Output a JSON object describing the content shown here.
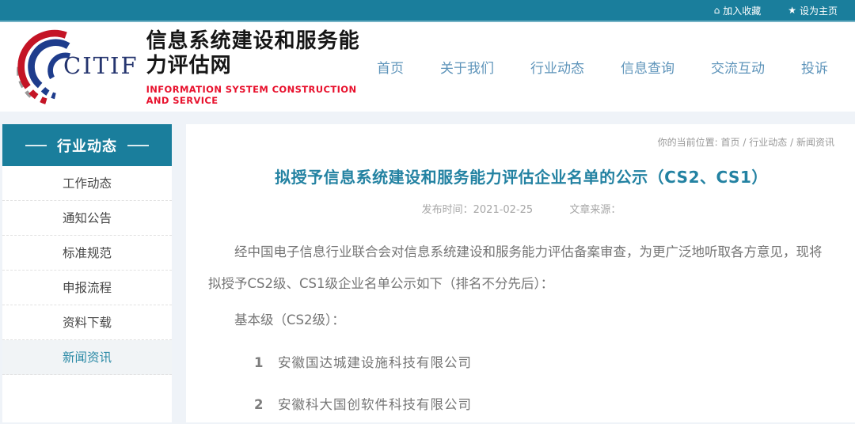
{
  "topbar": {
    "favorite_label": "加入收藏",
    "homepage_label": "设为主页"
  },
  "header": {
    "logo_text": "CITIF",
    "site_title": "信息系统建设和服务能力评估网",
    "site_subtitle": "INFORMATION SYSTEM CONSTRUCTION AND SERVICE",
    "nav": [
      {
        "label": "首页"
      },
      {
        "label": "关于我们"
      },
      {
        "label": "行业动态"
      },
      {
        "label": "信息查询"
      },
      {
        "label": "交流互动"
      },
      {
        "label": "投诉"
      }
    ]
  },
  "sidebar": {
    "title": "行业动态",
    "items": [
      {
        "label": "工作动态",
        "active": false
      },
      {
        "label": "通知公告",
        "active": false
      },
      {
        "label": "标准规范",
        "active": false
      },
      {
        "label": "申报流程",
        "active": false
      },
      {
        "label": "资料下载",
        "active": false
      },
      {
        "label": "新闻资讯",
        "active": true
      }
    ]
  },
  "main": {
    "breadcrumb": {
      "label": "你的当前位置:",
      "sep": "/",
      "items": [
        {
          "label": "首页"
        },
        {
          "label": "行业动态"
        },
        {
          "label": "新闻资讯"
        }
      ]
    },
    "article": {
      "title": "拟授予信息系统建设和服务能力评估企业名单的公示（CS2、CS1）",
      "publish_label": "发布时间：",
      "publish_date": "2021-02-25",
      "source_label": "文章来源：",
      "source_value": "",
      "paragraph": "经中国电子信息行业联合会对信息系统建设和服务能力评估备案审查，为更广泛地听取各方意见，现将拟授予CS2级、CS1级企业名单公示如下（排名不分先后）：",
      "section_heading": "基本级（CS2级）：",
      "companies": [
        {
          "num": "1",
          "name": "安徽国达城建设施科技有限公司"
        },
        {
          "num": "2",
          "name": "安徽科大国创软件科技有限公司"
        }
      ]
    }
  },
  "colors": {
    "teal": "#1a7e9c",
    "teal_light_border": "#74b2c5",
    "nav_blue": "#5e94ba",
    "title_teal": "#2382a2",
    "subtitle_red": "#e8112d",
    "logo_blue": "#25356f",
    "logo_red": "#c41425",
    "page_bg": "#eff3f8",
    "body_gray": "#757575",
    "meta_gray": "#a6a6a6"
  }
}
